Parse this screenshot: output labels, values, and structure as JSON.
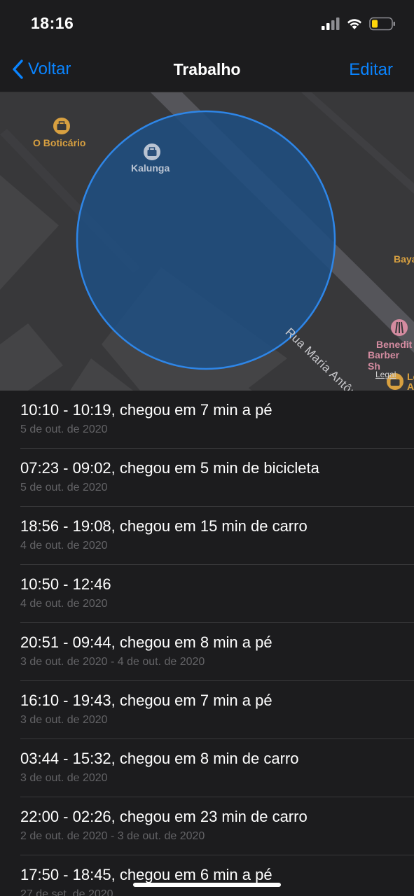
{
  "status_bar": {
    "time": "18:16"
  },
  "nav": {
    "back_label": "Voltar",
    "title": "Trabalho",
    "edit_label": "Editar"
  },
  "map": {
    "pois": {
      "boticario": "O Boticário",
      "kalunga": "Kalunga",
      "baya": "Baya",
      "benedito_line1": "Benedit",
      "benedito_line2": "Barber Sh",
      "partial": "Le",
      "partial2": "A"
    },
    "road": "Rua Maria Antônia",
    "legal": "Legal"
  },
  "colors": {
    "accent": "#0a84ff",
    "background": "#1c1c1e",
    "separator": "#38383a",
    "region_fill": "#1e4f82",
    "region_stroke": "#2e86e8",
    "shopping_poi": "#d8a040",
    "barber_poi": "#d48ba0"
  },
  "visits": [
    {
      "title": "10:10 - 10:19, chegou em 7 min a pé",
      "date": "5 de out. de 2020"
    },
    {
      "title": "07:23 - 09:02, chegou em 5 min de bicicleta",
      "date": "5 de out. de 2020"
    },
    {
      "title": "18:56 - 19:08, chegou em 15 min de carro",
      "date": "4 de out. de 2020"
    },
    {
      "title": "10:50 - 12:46",
      "date": "4 de out. de 2020"
    },
    {
      "title": "20:51 - 09:44, chegou em 8 min a pé",
      "date": "3 de out. de 2020 - 4 de out. de 2020"
    },
    {
      "title": "16:10 - 19:43, chegou em 7 min a pé",
      "date": "3 de out. de 2020"
    },
    {
      "title": "03:44 - 15:32, chegou em 8 min de carro",
      "date": "3 de out. de 2020"
    },
    {
      "title": "22:00 - 02:26, chegou em 23 min de carro",
      "date": "2 de out. de 2020 - 3 de out. de 2020"
    },
    {
      "title": "17:50 - 18:45, chegou em 6 min a pé",
      "date": "27 de set. de 2020"
    }
  ]
}
